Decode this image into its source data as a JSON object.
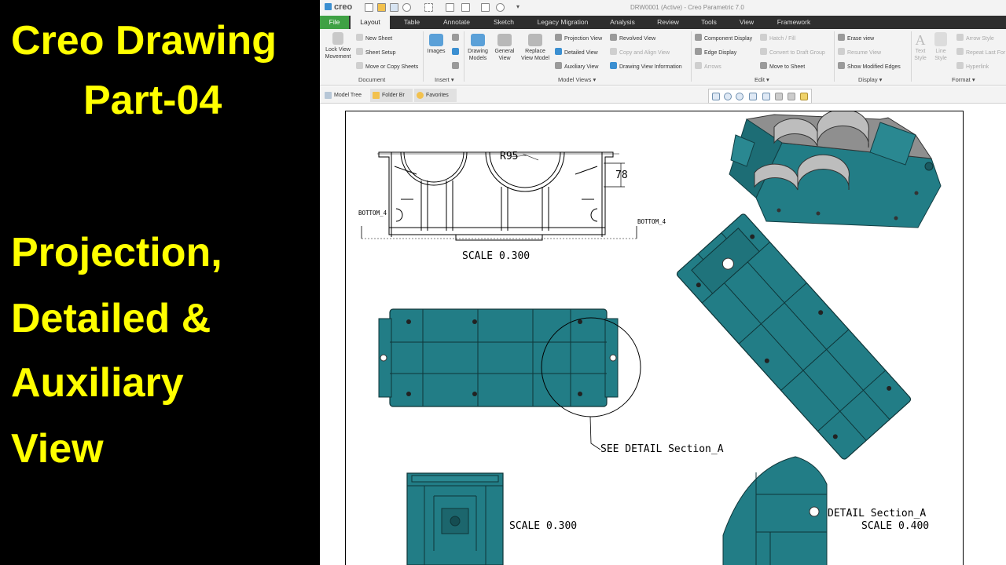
{
  "left_panel": {
    "line1": "Creo Drawing",
    "line2": "Part-04",
    "line3": "Projection,",
    "line4": "Detailed &",
    "line5": "Auxiliary",
    "line6": "View"
  },
  "colors": {
    "title_yellow": "#ffff00",
    "model_teal": "#227d86",
    "creo_green": "#3fa144"
  },
  "window": {
    "app_name": "creo",
    "title": "DRW0001 (Active) - Creo Parametric 7.0"
  },
  "tabs": [
    {
      "label": "File"
    },
    {
      "label": "Layout"
    },
    {
      "label": "Table"
    },
    {
      "label": "Annotate"
    },
    {
      "label": "Sketch"
    },
    {
      "label": "Legacy Migration"
    },
    {
      "label": "Analysis"
    },
    {
      "label": "Review"
    },
    {
      "label": "Tools"
    },
    {
      "label": "View"
    },
    {
      "label": "Framework"
    }
  ],
  "ribbon": {
    "document": {
      "lock_view": "Lock View",
      "lock_view2": "Movement",
      "new_sheet": "New Sheet",
      "sheet_setup": "Sheet Setup",
      "move_copy": "Move or Copy Sheets",
      "label": "Document"
    },
    "insert": {
      "images": "Images",
      "label": "Insert ▾"
    },
    "model_views": {
      "drawing_models": "Drawing",
      "drawing_models2": "Models",
      "general_view": "General",
      "general_view2": "View",
      "replace_view": "Replace",
      "replace_view2": "View Model",
      "projection_view": "Projection View",
      "detailed_view": "Detailed View",
      "auxiliary_view": "Auxiliary View",
      "revolved_view": "Revolved View",
      "copy_align": "Copy and Align View",
      "view_info": "Drawing View Information",
      "label": "Model Views ▾"
    },
    "edit": {
      "component_display": "Component Display",
      "edge_display": "Edge Display",
      "arrows": "Arrows",
      "hatch_fill": "Hatch / Fill",
      "convert_draft": "Convert to Draft Group",
      "move_to_sheet": "Move to Sheet",
      "label": "Edit ▾"
    },
    "display": {
      "erase_view": "Erase view",
      "resume_view": "Resume View",
      "show_modified": "Show Modified Edges",
      "label": "Display ▾"
    },
    "format": {
      "text_style": "Text",
      "text_style2": "Style",
      "line_style": "Line",
      "line_style2": "Style",
      "arrow_style": "Arrow Style",
      "repeat_last": "Repeat Last For",
      "hyperlink": "Hyperlink",
      "label": "Format ▾"
    }
  },
  "nav": {
    "model_tree": "Model Tree",
    "folder_browser": "Folder Br",
    "favorites": "Favorites"
  },
  "drawing": {
    "dim_radius": "R95",
    "dim_height": "78",
    "bottom_left": "BOTTOM_4",
    "bottom_right": "BOTTOM_4",
    "top_view_scale": "SCALE 0.300",
    "see_detail": "SEE DETAIL Section_A",
    "side_view_scale": "SCALE 0.300",
    "detail_name": "DETAIL Section_A",
    "detail_scale": "SCALE 0.400"
  }
}
